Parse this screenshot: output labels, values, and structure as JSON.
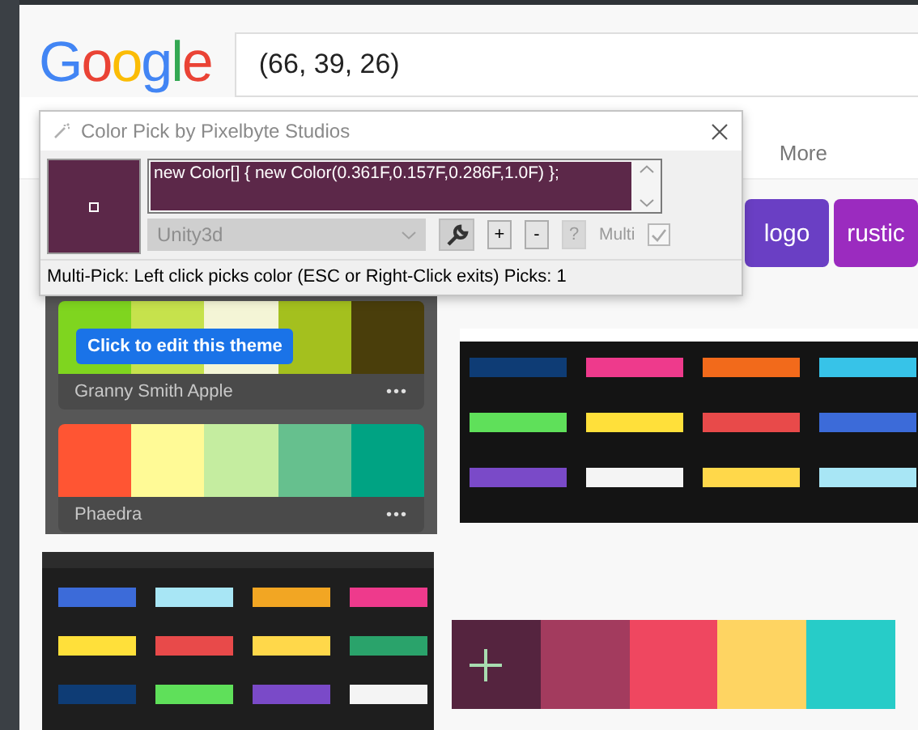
{
  "logo": "Google",
  "search": {
    "value": "(66, 39, 26)"
  },
  "nav": {
    "more": "More"
  },
  "chips": [
    {
      "label": "logo",
      "color": "#6a3fc4"
    },
    {
      "label": "rustic",
      "color": "#9b2bbf"
    }
  ],
  "color_pick": {
    "title": "Color Pick by Pixelbyte Studios",
    "color": "#5c2849",
    "code": "new Color[] { new Color(0.361F,0.157F,0.286F,1.0F) };",
    "format": "Unity3d",
    "buttons": [
      {
        "label": "+",
        "disabled": false
      },
      {
        "label": "-",
        "disabled": false
      },
      {
        "label": "?",
        "disabled": true
      }
    ],
    "multi": {
      "label": "Multi",
      "checked": true
    },
    "status": "Multi-Pick: Left click picks color (ESC or Right-Click exits) Picks: 1"
  },
  "results": [
    {
      "kind": "themes",
      "themes": [
        {
          "name": "Granny Smith Apple",
          "menu": "•••",
          "tooltip": "Click to edit this theme",
          "colors": [
            {
              "color": "#7fd51f"
            },
            {
              "color": "#c6e24c"
            },
            {
              "color": "#f4f5d6"
            },
            {
              "color": "#a4c01e"
            },
            {
              "color": "#4a3e0b"
            }
          ]
        },
        {
          "name": "Phaedra",
          "menu": "•••",
          "colors": [
            {
              "color": "#ff5533"
            },
            {
              "color": "#fffa96"
            },
            {
              "color": "#c5eda0"
            },
            {
              "color": "#66c08e"
            },
            {
              "color": "#00a383"
            }
          ]
        }
      ]
    },
    {
      "kind": "picture"
    },
    {
      "kind": "picture"
    },
    {
      "kind": "palette",
      "colors": [
        {
          "color": "#55243f"
        },
        {
          "color": "#a33b5e"
        },
        {
          "color": "#ef4760"
        },
        {
          "color": "#fed462"
        },
        {
          "color": "#27ccc8"
        }
      ]
    }
  ]
}
